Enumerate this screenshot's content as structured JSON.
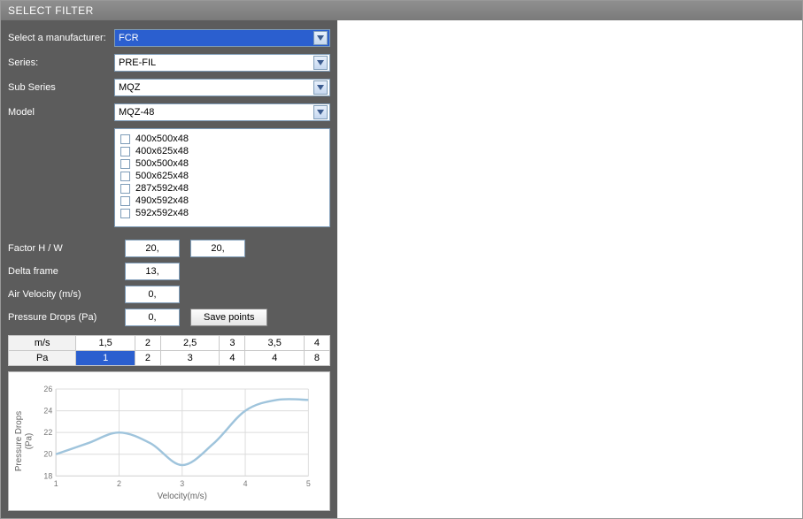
{
  "title": "SELECT FILTER",
  "form": {
    "manufacturer_label": "Select a manufacturer:",
    "manufacturer_value": "FCR",
    "series_label": "Series:",
    "series_value": "PRE-FIL",
    "subseries_label": "Sub Series",
    "subseries_value": "MQZ",
    "model_label": "Model",
    "model_value": "MQZ-48"
  },
  "sizes": [
    "400x500x48",
    "400x625x48",
    "500x500x48",
    "500x625x48",
    "287x592x48",
    "490x592x48",
    "592x592x48"
  ],
  "numeric": {
    "factor_label": "Factor H / W",
    "factor_h": "20,",
    "factor_w": "20,",
    "delta_label": "Delta frame",
    "delta": "13,",
    "air_label": "Air Velocity (m/s)",
    "air": "0,",
    "pd_label": "Pressure Drops (Pa)",
    "pd": "0,",
    "save_btn": "Save points"
  },
  "table": {
    "row1_label": "m/s",
    "row1": [
      "1,5",
      "2",
      "2,5",
      "3",
      "3,5",
      "4"
    ],
    "row2_label": "Pa",
    "row2": [
      "1",
      "2",
      "3",
      "4",
      "4",
      "8"
    ]
  },
  "chart_data": {
    "type": "line",
    "title": "",
    "xlabel": "Velocity(m/s)",
    "ylabel": "Pressure Drops\n(Pa)",
    "xlim": [
      1,
      5
    ],
    "ylim": [
      18,
      26
    ],
    "x_ticks": [
      1,
      2,
      3,
      4,
      5
    ],
    "y_ticks": [
      18,
      20,
      22,
      24,
      26
    ],
    "series": [
      {
        "name": "Pressure Drops",
        "x": [
          1,
          1.5,
          2,
          2.5,
          3,
          3.5,
          4,
          4.5,
          5
        ],
        "y": [
          20,
          21,
          22,
          21,
          19,
          21,
          24,
          25,
          25
        ]
      }
    ]
  }
}
